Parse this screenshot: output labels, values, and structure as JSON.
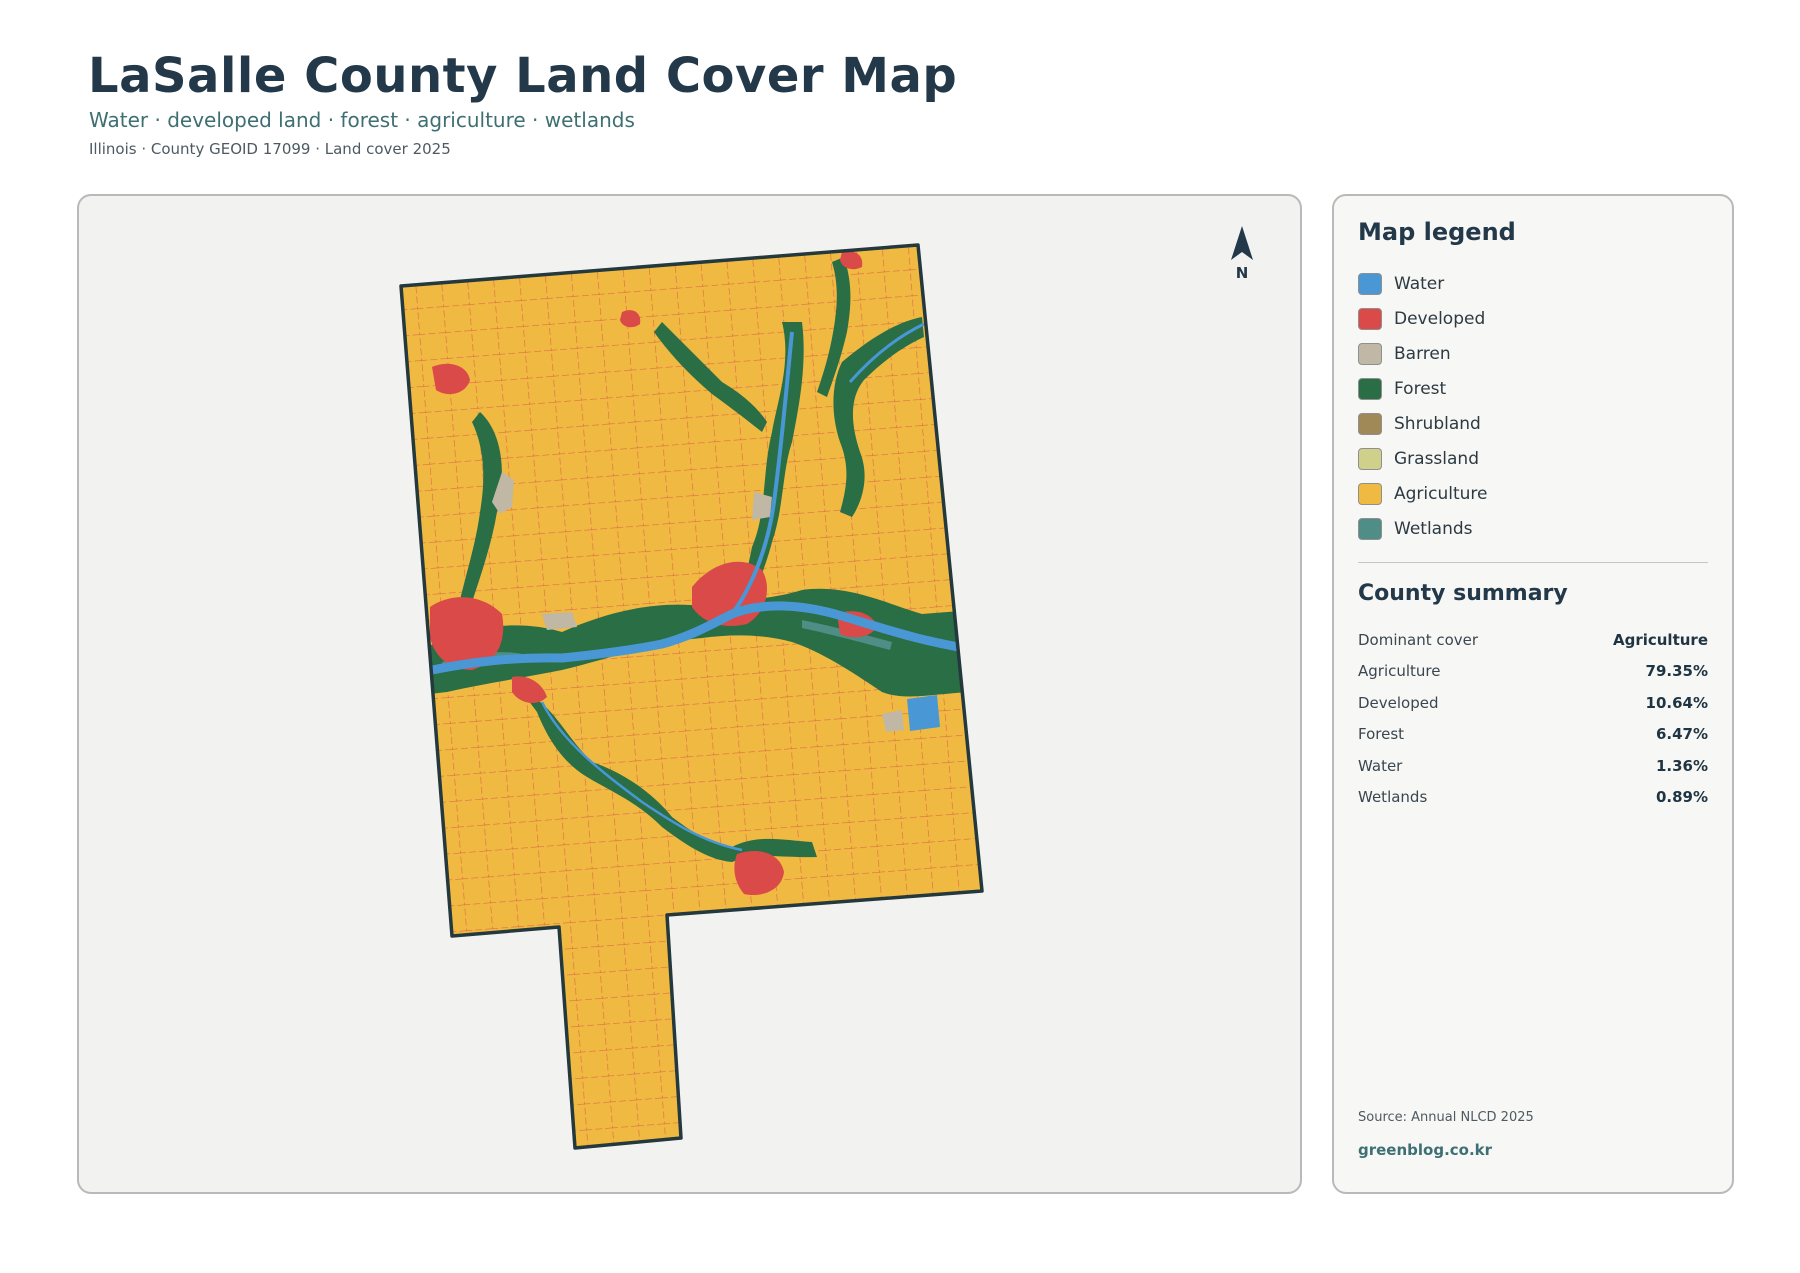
{
  "header": {
    "title": "LaSalle County Land Cover Map",
    "subtitle": "Water · developed land · forest · agriculture · wetlands",
    "meta": "Illinois · County GEOID 17099 · Land cover 2025"
  },
  "map": {
    "north_label": "N",
    "colors": {
      "water": "#4a97d6",
      "developed": "#d94a48",
      "barren": "#c0b8a4",
      "forest": "#2a6e45",
      "agriculture": "#f0ba42",
      "wetlands": "#4e8e86",
      "outline": "#23393d"
    }
  },
  "legend": {
    "title": "Map legend",
    "items": [
      {
        "label": "Water",
        "color": "#4a97d6"
      },
      {
        "label": "Developed",
        "color": "#d94a48"
      },
      {
        "label": "Barren",
        "color": "#c0b8a4"
      },
      {
        "label": "Forest",
        "color": "#2a6e45"
      },
      {
        "label": "Shrubland",
        "color": "#a08857"
      },
      {
        "label": "Grassland",
        "color": "#cfd08a"
      },
      {
        "label": "Agriculture",
        "color": "#f0ba42"
      },
      {
        "label": "Wetlands",
        "color": "#4e8e86"
      }
    ]
  },
  "summary": {
    "title": "County summary",
    "rows": [
      {
        "label": "Dominant cover",
        "value": "Agriculture"
      },
      {
        "label": "Agriculture",
        "value": "79.35%"
      },
      {
        "label": "Developed",
        "value": "10.64%"
      },
      {
        "label": "Forest",
        "value": "6.47%"
      },
      {
        "label": "Water",
        "value": "1.36%"
      },
      {
        "label": "Wetlands",
        "value": "0.89%"
      }
    ]
  },
  "footer": {
    "source": "Source: Annual NLCD 2025",
    "site": "greenblog.co.kr"
  }
}
